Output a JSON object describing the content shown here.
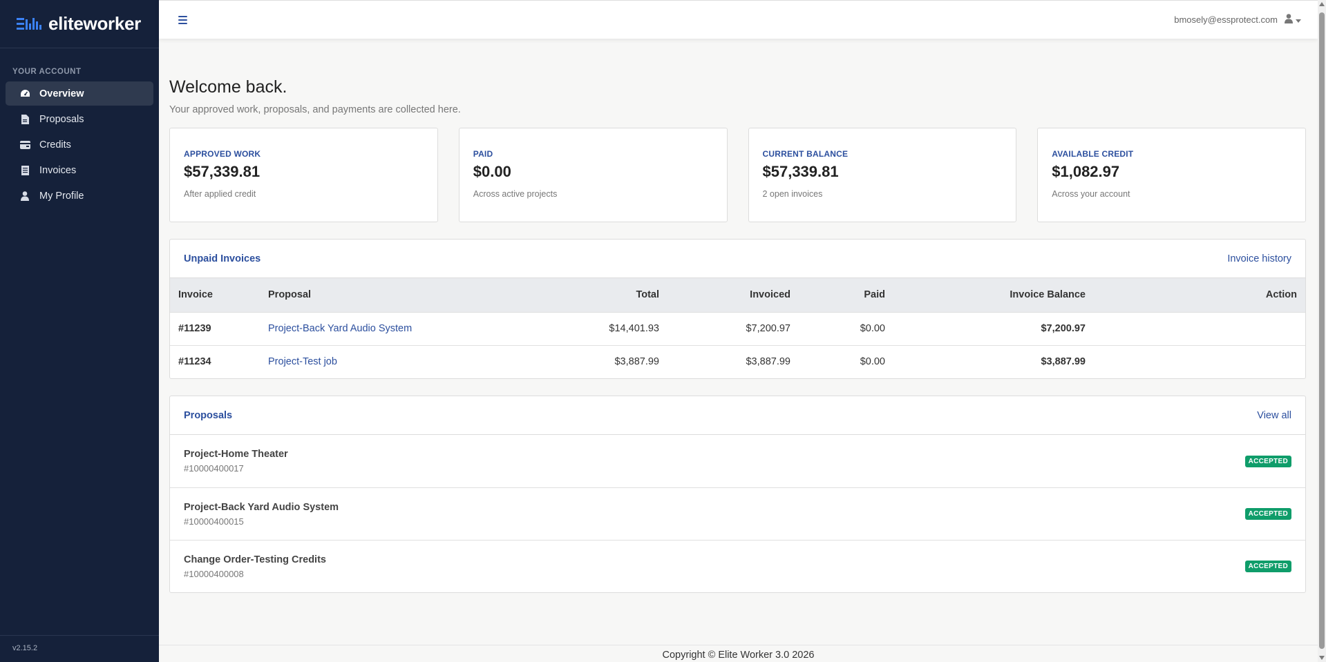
{
  "brand": {
    "name": "eliteworker"
  },
  "sidebar": {
    "section_label": "YOUR ACCOUNT",
    "items": [
      {
        "label": "Overview",
        "icon": "gauge-icon",
        "active": true
      },
      {
        "label": "Proposals",
        "icon": "document-icon",
        "active": false
      },
      {
        "label": "Credits",
        "icon": "wallet-icon",
        "active": false
      },
      {
        "label": "Invoices",
        "icon": "receipt-icon",
        "active": false
      },
      {
        "label": "My Profile",
        "icon": "user-icon",
        "active": false
      }
    ],
    "version": "v2.15.2"
  },
  "topbar": {
    "user_email": "bmosely@essprotect.com"
  },
  "page": {
    "title": "Welcome back.",
    "subtitle": "Your approved work, proposals, and payments are collected here."
  },
  "stats": [
    {
      "label": "APPROVED WORK",
      "value": "$57,339.81",
      "sub": "After applied credit"
    },
    {
      "label": "PAID",
      "value": "$0.00",
      "sub": "Across active projects"
    },
    {
      "label": "CURRENT BALANCE",
      "value": "$57,339.81",
      "sub": "2 open invoices"
    },
    {
      "label": "AVAILABLE CREDIT",
      "value": "$1,082.97",
      "sub": "Across your account"
    }
  ],
  "unpaid_invoices": {
    "title": "Unpaid Invoices",
    "link": "Invoice history",
    "columns": [
      "Invoice",
      "Proposal",
      "Total",
      "Invoiced",
      "Paid",
      "Invoice Balance",
      "Action"
    ],
    "rows": [
      {
        "invoice": "#11239",
        "proposal": "Project-Back Yard Audio System",
        "total": "$14,401.93",
        "invoiced": "$7,200.97",
        "paid": "$0.00",
        "balance": "$7,200.97",
        "action": ""
      },
      {
        "invoice": "#11234",
        "proposal": "Project-Test job",
        "total": "$3,887.99",
        "invoiced": "$3,887.99",
        "paid": "$0.00",
        "balance": "$3,887.99",
        "action": ""
      }
    ]
  },
  "proposals": {
    "title": "Proposals",
    "link": "View all",
    "items": [
      {
        "name": "Project-Home Theater",
        "number": "#10000400017",
        "status": "ACCEPTED"
      },
      {
        "name": "Project-Back Yard Audio System",
        "number": "#10000400015",
        "status": "ACCEPTED"
      },
      {
        "name": "Change Order-Testing Credits",
        "number": "#10000400008",
        "status": "ACCEPTED"
      }
    ]
  },
  "footer": {
    "copyright": "Copyright © Elite Worker 3.0 2026"
  },
  "colors": {
    "sidebar_bg": "#15213a",
    "accent": "#2c4f9e",
    "badge_green": "#0f9d6a"
  }
}
